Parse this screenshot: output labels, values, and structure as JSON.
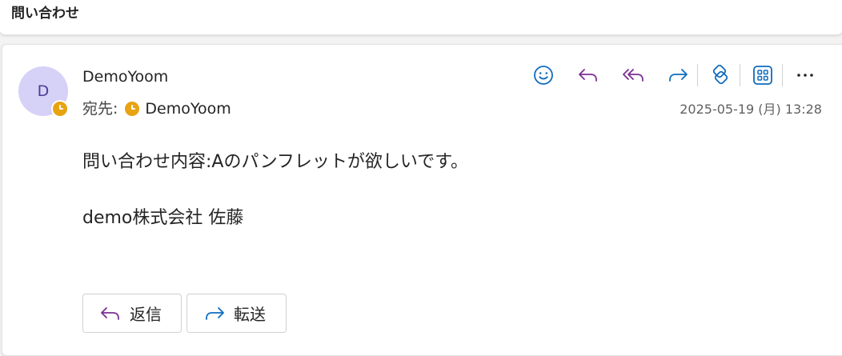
{
  "subject": "問い合わせ",
  "message": {
    "avatar_initial": "D",
    "sender": "DemoYoom",
    "to_label": "宛先:",
    "recipient": "DemoYoom",
    "date": "2025-05-19 (月) 13:28",
    "body_line1": "問い合わせ内容:Aのパンフレットが欲しいです。",
    "body_line2": "demo株式会社 佐藤"
  },
  "actions": {
    "reply_label": "返信",
    "forward_label": "転送"
  },
  "toolbar": {
    "icons": [
      "emoji-icon",
      "reply-icon",
      "reply-all-icon",
      "forward-icon",
      "loop-app-icon",
      "apps-icon",
      "more-icon"
    ]
  },
  "colors": {
    "accent_blue": "#0f6cbd",
    "reply_purple": "#7b2f92",
    "avatar_bg": "#d6d1f7",
    "status_clock": "#e8a311"
  }
}
